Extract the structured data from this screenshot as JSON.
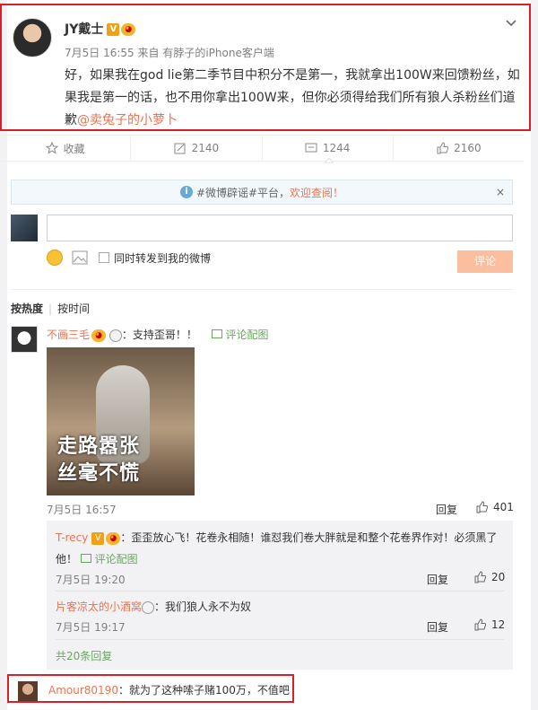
{
  "post": {
    "author": "JY戴士",
    "v_badge": "V",
    "time": "7月5日 16:55",
    "source_prefix": "来自",
    "source": "有脖子的iPhone客户端",
    "text": "好，如果我在god lie第二季节目中积分不是第一，我就拿出100W来回馈粉丝，如果我是第一的话，也不用你拿出100W来，但你必须得给我们所有狼人杀粉丝们道歉",
    "mention": "@卖兔子的小萝卜"
  },
  "actions": {
    "favorite": "收藏",
    "repost": "2140",
    "comment": "1244",
    "like": "2160"
  },
  "notice": {
    "tag": "#微博辟谣#平台，",
    "link": "欢迎查阅！",
    "close": "×"
  },
  "compose": {
    "checkbox_label": "同时转发到我的微博",
    "submit": "评论"
  },
  "sort": {
    "hot": "按热度",
    "time": "按时间"
  },
  "comments": [
    {
      "user": "不画三毛",
      "text": "：支持歪哥！！",
      "image_link": "评论配图",
      "image_caption_1": "走路嚣张",
      "image_caption_2": "丝毫不慌",
      "time": "7月5日 16:57",
      "reply": "回复",
      "likes": "401",
      "replies": [
        {
          "user": "T-recy",
          "text_1": "：歪歪放心飞！花卷永相随！谁怼我们卷大胖就是和整个花卷界作对！必须黑了",
          "text_2": "他！",
          "image_link": "评论配图",
          "time": "7月5日 19:20",
          "reply": "回复",
          "likes": "20"
        },
        {
          "user": "片客凉太的小酒窝",
          "text": "：我们狼人永不为奴",
          "time": "7月5日 19:17",
          "reply": "回复",
          "likes": "12"
        }
      ],
      "more": "共20条回复"
    },
    {
      "user": "Amour80190",
      "text": "：就为了这种嗦子赌100万，不值吧"
    }
  ]
}
